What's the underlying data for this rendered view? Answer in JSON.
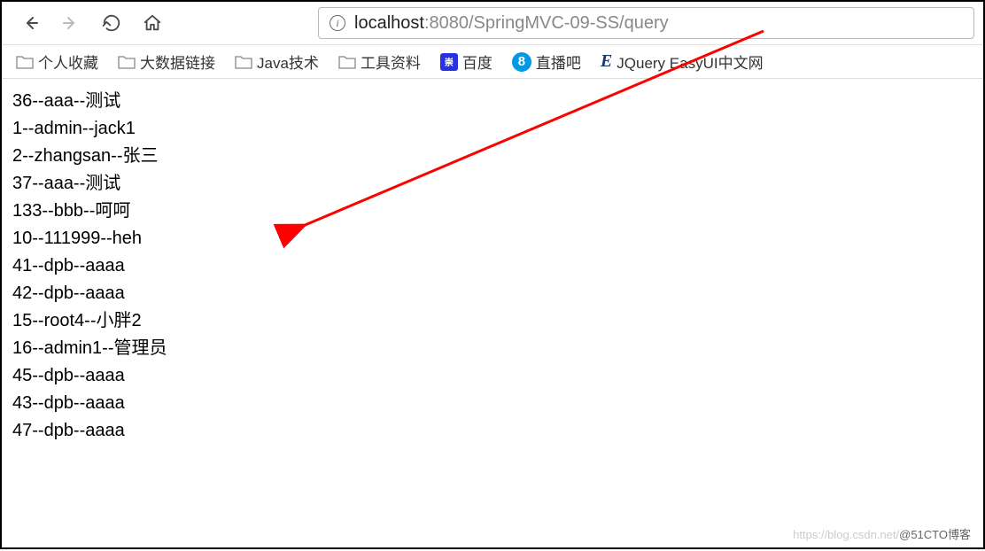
{
  "nav": {
    "back_label": "Back",
    "forward_label": "Forward",
    "reload_label": "Reload",
    "home_label": "Home"
  },
  "address": {
    "host": "localhost",
    "port_path": ":8080/SpringMVC-09-SS/query"
  },
  "bookmarks": [
    {
      "label": "个人收藏",
      "icon": "folder"
    },
    {
      "label": "大数据链接",
      "icon": "folder"
    },
    {
      "label": "Java技术",
      "icon": "folder"
    },
    {
      "label": "工具资料",
      "icon": "folder"
    },
    {
      "label": "百度",
      "icon": "baidu"
    },
    {
      "label": "直播吧",
      "icon": "zhibo"
    },
    {
      "label": "JQuery EasyUI中文网",
      "icon": "jquery"
    }
  ],
  "page_lines": [
    "36--aaa--测试",
    "1--admin--jack1",
    "2--zhangsan--张三",
    "37--aaa--测试",
    "133--bbb--呵呵",
    "10--111999--heh",
    "41--dpb--aaaa",
    "42--dpb--aaaa",
    "15--root4--小胖2",
    "16--admin1--管理员",
    "45--dpb--aaaa",
    "43--dpb--aaaa",
    "47--dpb--aaaa"
  ],
  "watermark": {
    "light": "https://blog.csdn.net/",
    "dark": "@51CTO博客"
  },
  "icons": {
    "baidu_glyph": "崇",
    "zhibo_glyph": "8",
    "jquery_glyph": "E"
  }
}
